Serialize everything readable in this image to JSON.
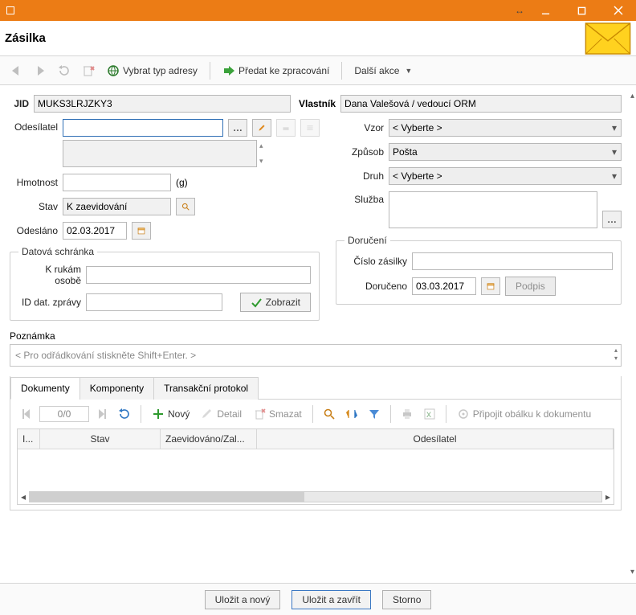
{
  "window_title": "Zásilka",
  "titlebar": {
    "restore_hint": "↔"
  },
  "toolbar": {
    "addr_label": "Vybrat typ adresy",
    "process_label": "Předat ke zpracování",
    "more_label": "Další akce"
  },
  "ident": {
    "jid_label": "JID",
    "jid_value": "MUKS3LRJZKY3",
    "owner_label": "Vlastník",
    "owner_value": "Dana Valešová / vedoucí ORM"
  },
  "left": {
    "sender_label": "Odesílatel",
    "weight_label": "Hmotnost",
    "weight_unit": "(g)",
    "status_label": "Stav",
    "status_value": "K zaevidování",
    "sent_label": "Odesláno",
    "sent_value": "02.03.2017",
    "ds_legend": "Datová schránka",
    "ds_hands_label": "K rukám osobě",
    "ds_id_label": "ID dat. zprávy",
    "ds_show_label": "Zobrazit"
  },
  "right": {
    "template_label": "Vzor",
    "template_value": "< Vyberte >",
    "method_label": "Způsob",
    "method_value": "Pošta",
    "kind_label": "Druh",
    "kind_value": "< Vyberte >",
    "service_label": "Služba",
    "delivery_legend": "Doručení",
    "shipment_no_label": "Číslo zásilky",
    "delivered_label": "Doručeno",
    "delivered_value": "03.03.2017",
    "sign_label": "Podpis"
  },
  "note": {
    "label": "Poznámka",
    "placeholder": "< Pro odřádkování stiskněte Shift+Enter. >"
  },
  "tabs": {
    "t1": "Dokumenty",
    "t2": "Komponenty",
    "t3": "Transakční protokol",
    "counter": "0/0",
    "new_label": "Nový",
    "detail_label": "Detail",
    "delete_label": "Smazat",
    "attach_label": "Připojit obálku k dokumentu",
    "col_idx": "I...",
    "col_status": "Stav",
    "col_reg": "Zaevidováno/Zal...",
    "col_sender": "Odesílatel"
  },
  "footer": {
    "save_new": "Uložit a nový",
    "save_close": "Uložit a zavřít",
    "cancel": "Storno"
  }
}
